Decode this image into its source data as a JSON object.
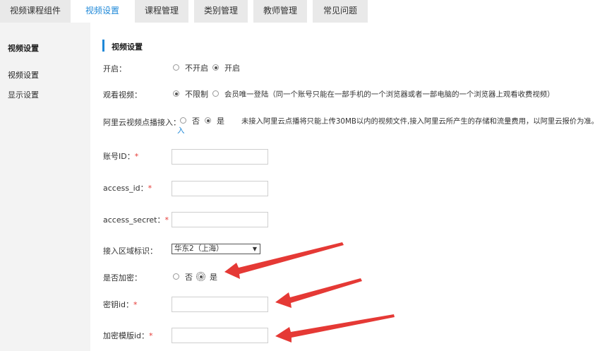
{
  "tabs": [
    {
      "label": "视频课程组件"
    },
    {
      "label": "视频设置"
    },
    {
      "label": "课程管理"
    },
    {
      "label": "类别管理"
    },
    {
      "label": "教师管理"
    },
    {
      "label": "常见问题"
    }
  ],
  "sidebar": {
    "title": "视频设置",
    "items": [
      {
        "label": "视频设置"
      },
      {
        "label": "显示设置"
      }
    ]
  },
  "section": {
    "title": "视频设置"
  },
  "form": {
    "enable": {
      "label": "开启：",
      "option_off": "不开启",
      "option_on": "开启",
      "selected": "开启"
    },
    "watch": {
      "label": "观看视频：",
      "option_unlimited": "不限制",
      "option_member": "会员唯一登陆（同一个账号只能在一部手机的一个浏览器或者一部电脑的一个浏览器上观看收费视频）",
      "selected": "不限制"
    },
    "aliyun": {
      "label": "阿里云视频点播接入：",
      "label_tail": "入",
      "option_no": "否",
      "option_yes": "是",
      "selected": "是",
      "hint": "未接入阿里云点播将只能上传30MB以内的视频文件,接入阿里云所产生的存储和流量费用，以阿里云报价为准。"
    },
    "account_id": {
      "label": "账号ID：",
      "required": "*",
      "value": ""
    },
    "access_id": {
      "label": "access_id：",
      "required": "*",
      "value": ""
    },
    "access_secret": {
      "label": "access_secret：",
      "required": "*",
      "value": ""
    },
    "region": {
      "label": "接入区域标识：",
      "selected": "华东2（上海）"
    },
    "encrypt": {
      "label": "是否加密：",
      "option_no": "否",
      "option_yes": "是",
      "selected": "是"
    },
    "key_id": {
      "label": "密钥id：",
      "required": "*",
      "value": ""
    },
    "template_id": {
      "label": "加密模版id：",
      "required": "*",
      "value": ""
    }
  },
  "annotations": {
    "arrow_color": "#e53935"
  },
  "colors": {
    "accent": "#1e88d8",
    "sidebar_bg": "#f3f3f3",
    "tab_bg": "#e9e9e9"
  }
}
